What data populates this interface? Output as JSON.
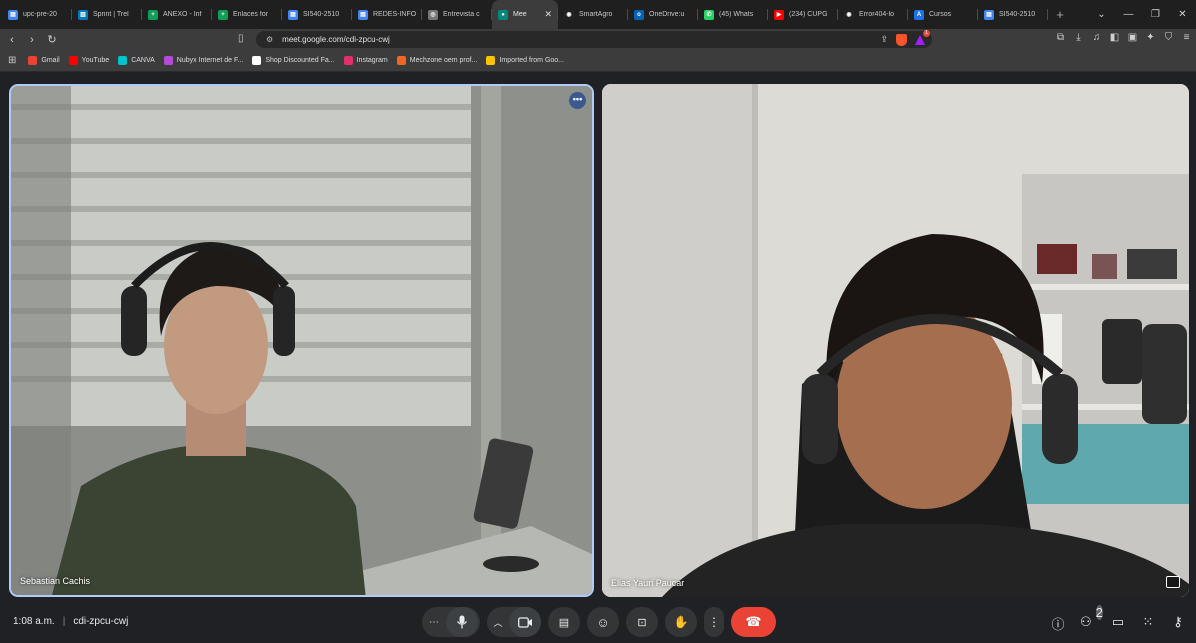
{
  "browser": {
    "tabs": [
      {
        "label": "upc-pre-20",
        "color": "#4285f4",
        "glyph": "▤"
      },
      {
        "label": "Sprint | Trel",
        "color": "#0079bf",
        "glyph": "▥"
      },
      {
        "label": "ANEXO - Inf",
        "color": "#0f9d58",
        "glyph": "+"
      },
      {
        "label": "Enlaces for",
        "color": "#0f9d58",
        "glyph": "+"
      },
      {
        "label": "SI540-2510",
        "color": "#4285f4",
        "glyph": "▤"
      },
      {
        "label": "REDES-INFO",
        "color": "#4285f4",
        "glyph": "▤"
      },
      {
        "label": "Entrevista c",
        "color": "#777777",
        "glyph": "◎"
      },
      {
        "label": "Mee",
        "color": "#00897b",
        "glyph": "●",
        "active": true
      },
      {
        "label": "SmartAgro",
        "color": "#222222",
        "glyph": "◉"
      },
      {
        "label": "OneDrive:u",
        "color": "#0364b8",
        "glyph": "o"
      },
      {
        "label": "(45) Whats",
        "color": "#25d366",
        "glyph": "✆"
      },
      {
        "label": "(234) CUPG",
        "color": "#ff0000",
        "glyph": "▶"
      },
      {
        "label": "Error404-lo",
        "color": "#222222",
        "glyph": "◉"
      },
      {
        "label": "Cursos",
        "color": "#1a73e8",
        "glyph": "A"
      },
      {
        "label": "SI540-2510",
        "color": "#4285f4",
        "glyph": "▤"
      }
    ],
    "url": "meet.google.com/cdi-zpcu-cwj",
    "bat_badge": "1",
    "bookmarks": [
      {
        "label": "Gmail",
        "color": "#ea4335"
      },
      {
        "label": "YouTube",
        "color": "#ff0000"
      },
      {
        "label": "CANVA",
        "color": "#00c4cc"
      },
      {
        "label": "Nubyx Internet de F...",
        "color": "#b24bd6"
      },
      {
        "label": "Shop Discounted Fa...",
        "color": "#ffffff"
      },
      {
        "label": "Instagram",
        "color": "#e1306c"
      },
      {
        "label": "Mechzone oem prof...",
        "color": "#f26522"
      },
      {
        "label": "Imported from Goo...",
        "color": "#f9c400"
      }
    ]
  },
  "meet": {
    "participants": [
      {
        "name": "Sebastian Cachis",
        "more_label": "•••"
      },
      {
        "name": "Elias Yauri Paucar"
      }
    ],
    "time": "1:08 a.m.",
    "meeting_code": "cdi-zpcu-cwj",
    "participant_count": "2"
  }
}
